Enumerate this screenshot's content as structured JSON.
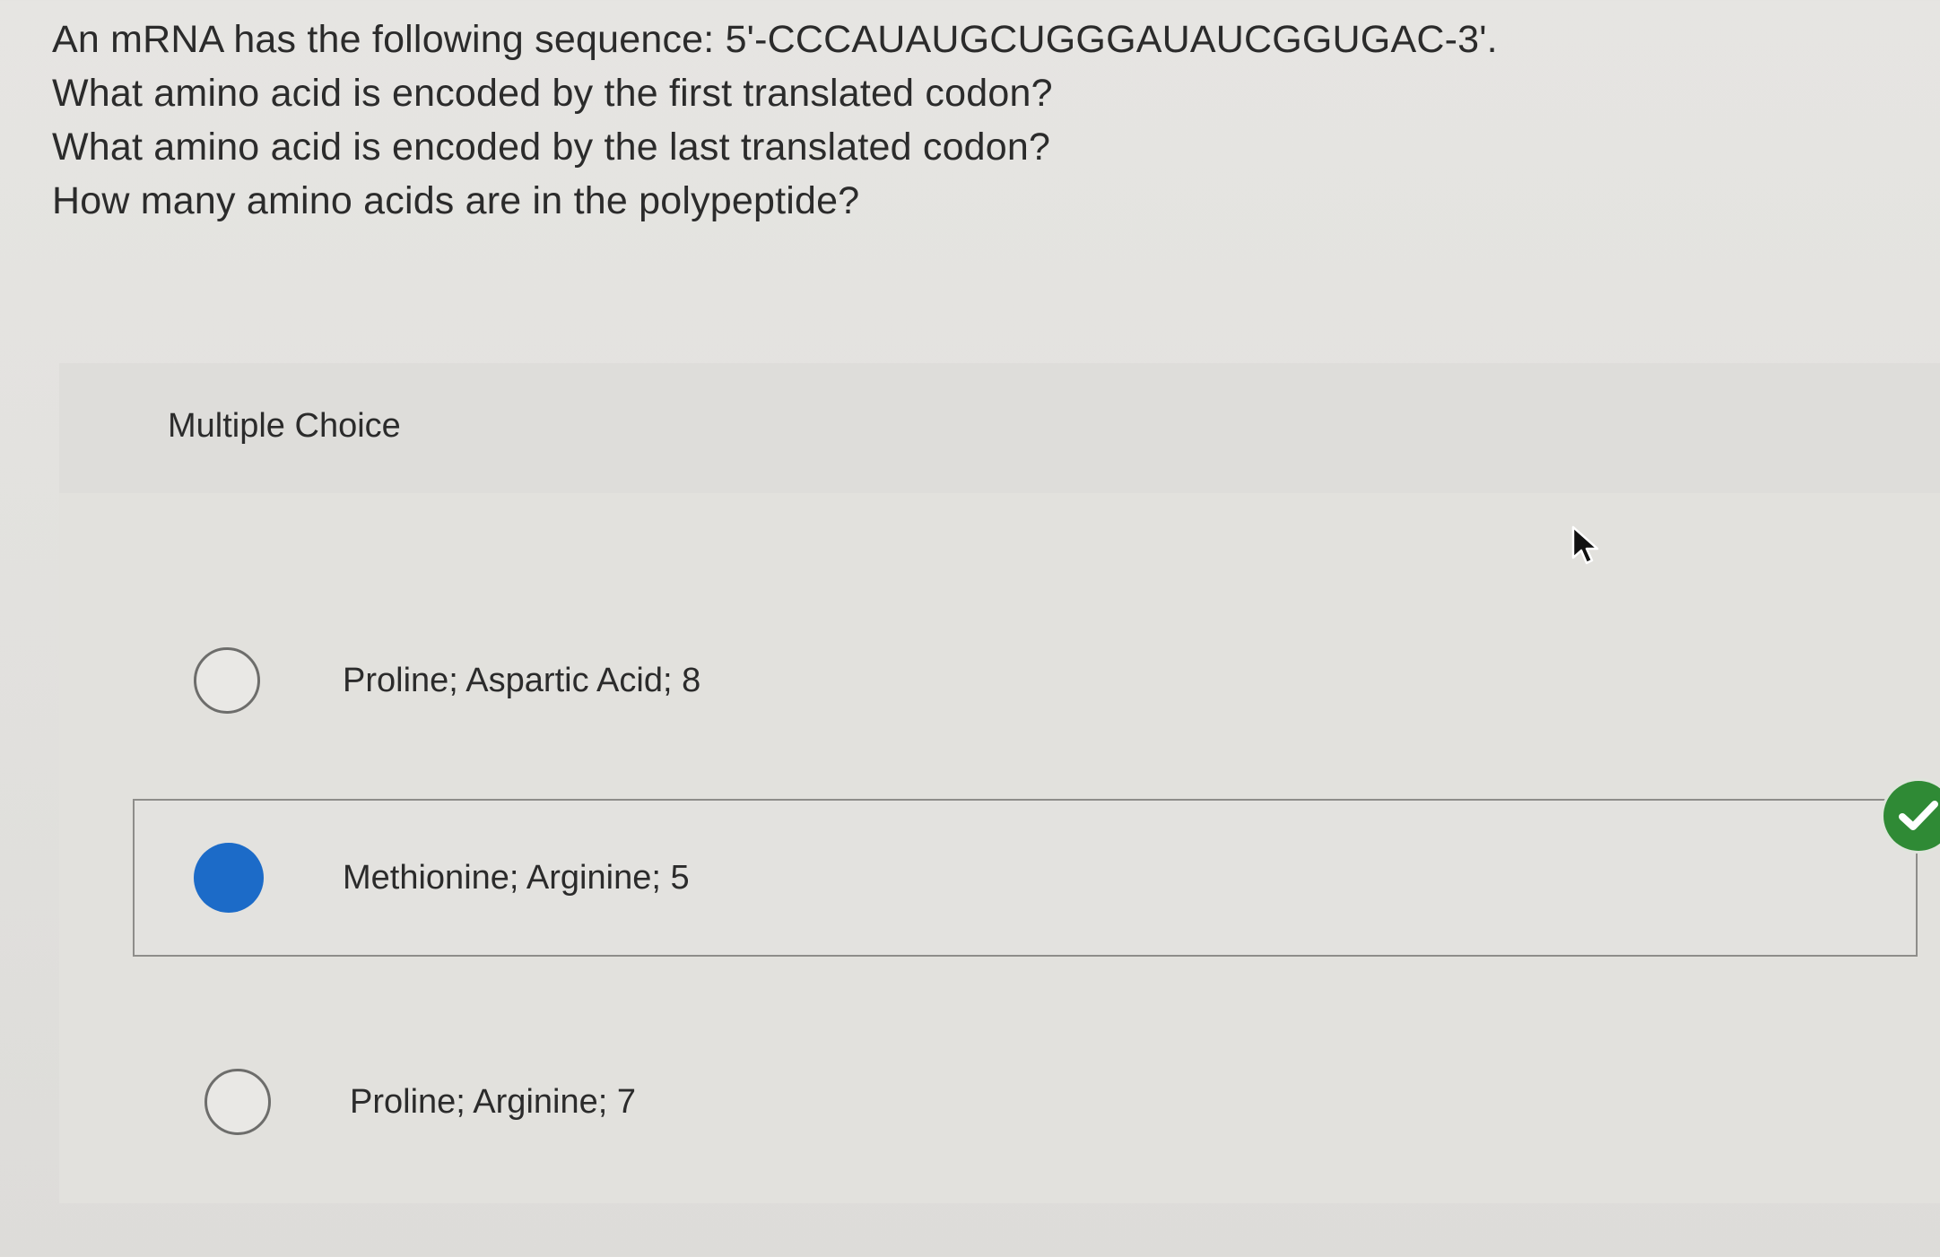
{
  "question": {
    "lines": [
      "An mRNA has the following sequence: 5'-CCCAUAUGCUGGGAUAUCGGUGAC-3'.",
      "What amino acid is encoded by the first translated codon?",
      "What amino acid is encoded by the last translated codon?",
      "How many amino acids are in the polypeptide?"
    ]
  },
  "multiple_choice": {
    "label": "Multiple Choice",
    "options": [
      {
        "text": "Proline; Aspartic Acid; 8",
        "selected": false,
        "correct": false
      },
      {
        "text": "Methionine; Arginine; 5",
        "selected": true,
        "correct": true
      },
      {
        "text": "Proline; Arginine; 7",
        "selected": false,
        "correct": false
      }
    ]
  },
  "icons": {
    "correct": "checkmark-icon",
    "pointer": "mouse-cursor-icon"
  },
  "colors": {
    "selected_radio": "#1c6bc8",
    "correct_badge": "#2f8a35",
    "background": "#e2e1dd"
  }
}
